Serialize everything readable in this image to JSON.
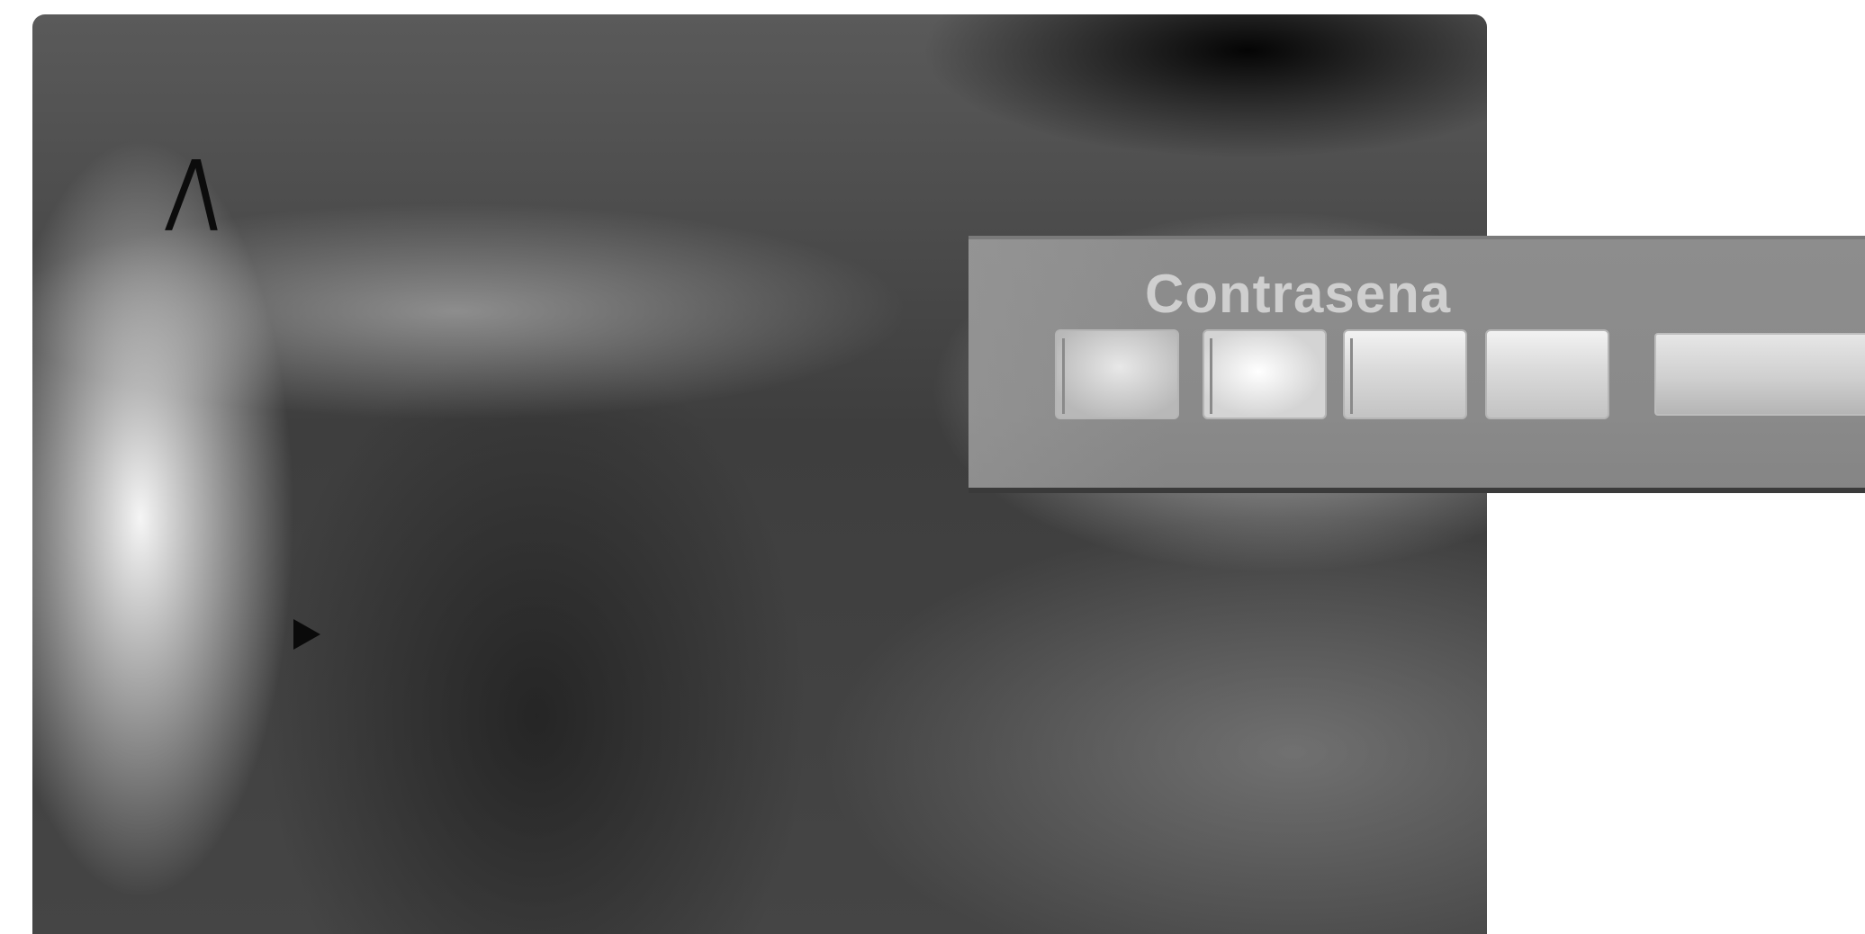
{
  "screen": {
    "brand_glyph": "/\\"
  },
  "password_dialog": {
    "title": "Contrasena",
    "digits": [
      "",
      "",
      "",
      ""
    ],
    "ok_button_label": ""
  },
  "colors": {
    "screen_base": "#454545",
    "panel": "#8a8a8a",
    "title_text": "#cfcfcf",
    "background": "#ffffff"
  }
}
